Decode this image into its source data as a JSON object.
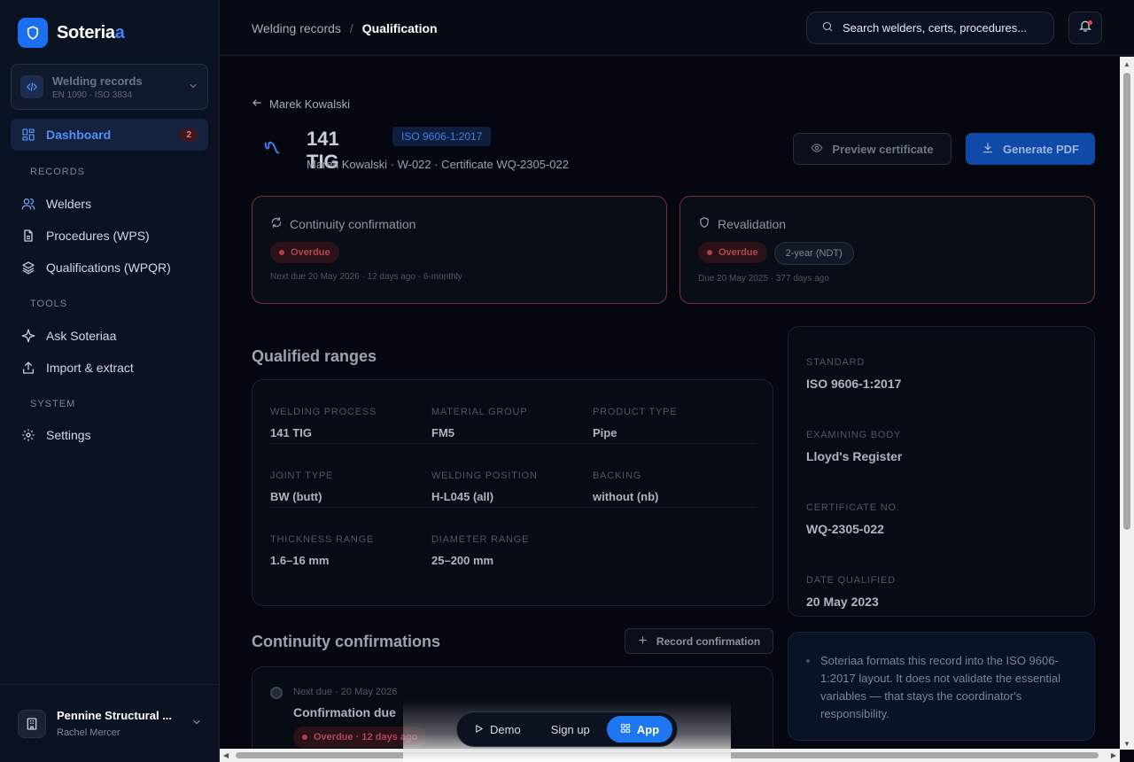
{
  "brand": {
    "name_main": "Soteria",
    "name_accent": "a"
  },
  "workspace": {
    "title": "Welding records",
    "subtitle": "EN 1090 · ISO 3834"
  },
  "nav": {
    "dashboard": {
      "label": "Dashboard",
      "badge": "2"
    },
    "section_records": "RECORDS",
    "welders": "Welders",
    "procedures": "Procedures (WPS)",
    "qualifications": "Qualifications (WPQR)",
    "section_tools": "TOOLS",
    "ask": "Ask Soteriaa",
    "import": "Import & extract",
    "section_system": "SYSTEM",
    "settings": "Settings"
  },
  "org": {
    "name": "Pennine Structural ...",
    "user": "Rachel Mercer"
  },
  "header": {
    "breadcrumb_parent": "Welding records",
    "breadcrumb_sep": "/",
    "breadcrumb_current": "Qualification",
    "search_placeholder": "Search welders, certs, procedures..."
  },
  "page": {
    "back_label": "Marek Kowalski",
    "title": "141 TIG",
    "standard_pill": "ISO 9606-1:2017",
    "subtitle": "Marek Kowalski · W-022 · Certificate WQ-2305-022",
    "preview_label": "Preview certificate",
    "pdf_label": "Generate PDF"
  },
  "alerts": {
    "continuity": {
      "title": "Continuity confirmation",
      "status": "Overdue",
      "note": "Next due 20 May 2026 · 12 days ago · 6-monthly"
    },
    "revalidation": {
      "title": "Revalidation",
      "status": "Overdue",
      "tag": "2-year (NDT)",
      "note": "Due 20 May 2025 · 377 days ago"
    }
  },
  "ranges": {
    "title": "Qualified ranges",
    "rows": [
      [
        {
          "label": "WELDING PROCESS",
          "value": "141 TIG"
        },
        {
          "label": "MATERIAL GROUP",
          "value": "FM5"
        },
        {
          "label": "PRODUCT TYPE",
          "value": "Pipe"
        }
      ],
      [
        {
          "label": "JOINT TYPE",
          "value": "BW (butt)"
        },
        {
          "label": "WELDING POSITION",
          "value": "H-L045 (all)"
        },
        {
          "label": "BACKING",
          "value": "without (nb)"
        }
      ],
      [
        {
          "label": "THICKNESS RANGE",
          "value": "1.6–16 mm"
        },
        {
          "label": "DIAMETER RANGE",
          "value": "25–200 mm"
        }
      ]
    ]
  },
  "standard_card": [
    {
      "label": "STANDARD",
      "value": "ISO 9606-1:2017"
    },
    {
      "label": "EXAMINING BODY",
      "value": "Lloyd's Register"
    },
    {
      "label": "CERTIFICATE NO.",
      "value": "WQ-2305-022"
    },
    {
      "label": "DATE QUALIFIED",
      "value": "20 May 2023"
    }
  ],
  "continuity": {
    "title": "Continuity confirmations",
    "record_label": "Record confirmation",
    "item": {
      "meta": "Next due · 20 May 2026",
      "title": "Confirmation due",
      "status": "Overdue · 12 days ago"
    }
  },
  "info": {
    "text": "Soteriaa formats this record into the ISO 9606-1:2017 layout. It does not validate the essential variables — that stays the coordinator's responsibility."
  },
  "floatbar": {
    "demo": "Demo",
    "signup": "Sign up",
    "app": "App"
  },
  "colors": {
    "accent": "#1d6ff2",
    "danger": "#b63b48",
    "background": "#04070f",
    "sidebar": "#0b1221"
  }
}
